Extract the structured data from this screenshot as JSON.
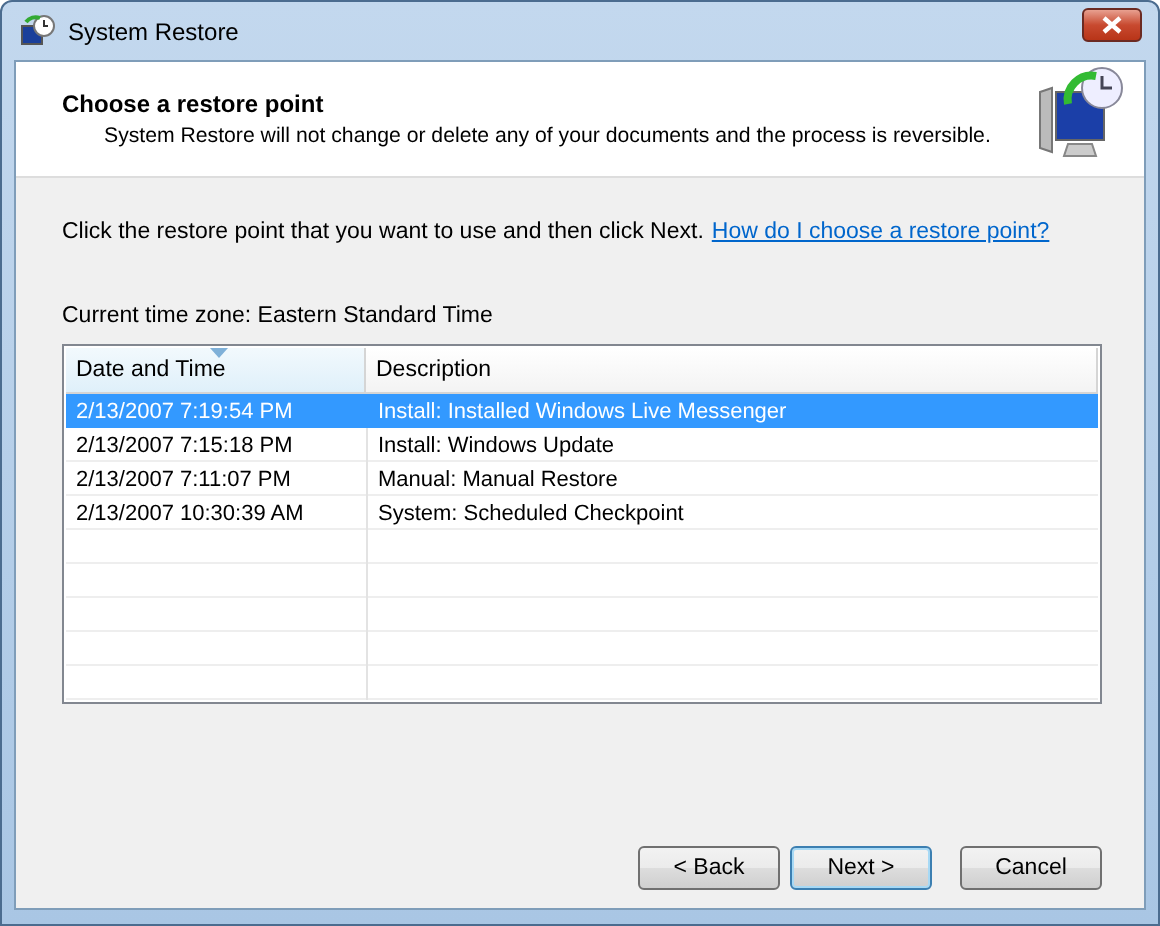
{
  "window": {
    "title": "System Restore"
  },
  "header": {
    "title": "Choose a restore point",
    "subtitle": "System Restore will not change or delete any of your documents and the process is reversible."
  },
  "instruction": {
    "text": "Click the restore point that you want to use and then click Next.",
    "link": "How do I choose a restore point?"
  },
  "time_zone": "Current time zone: Eastern Standard Time",
  "table": {
    "columns": [
      {
        "label": "Date and Time",
        "sorted": true
      },
      {
        "label": "Description",
        "sorted": false
      }
    ],
    "rows": [
      {
        "cells": [
          "2/13/2007 7:19:54 PM",
          "Install: Installed Windows Live Messenger"
        ],
        "selected": true
      },
      {
        "cells": [
          "2/13/2007 7:15:18 PM",
          "Install: Windows Update"
        ],
        "selected": false
      },
      {
        "cells": [
          "2/13/2007 7:11:07 PM",
          "Manual: Manual Restore"
        ],
        "selected": false
      },
      {
        "cells": [
          "2/13/2007 10:30:39 AM",
          "System: Scheduled Checkpoint"
        ],
        "selected": false
      }
    ]
  },
  "buttons": [
    {
      "label": "< Back",
      "default": false
    },
    {
      "label": "Next >",
      "default": true
    },
    {
      "label": "Cancel",
      "default": false
    }
  ]
}
